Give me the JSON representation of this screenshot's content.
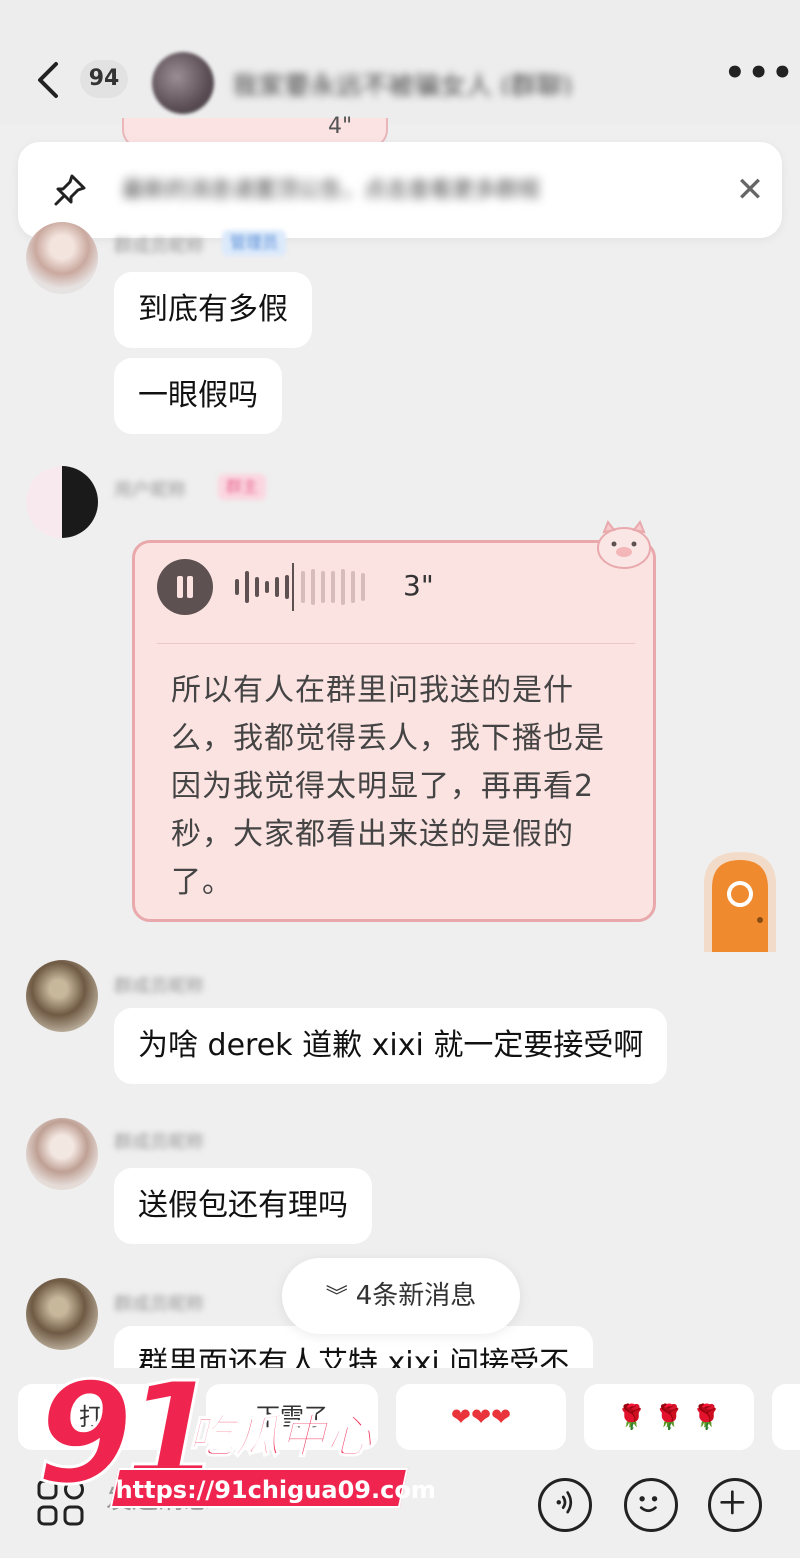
{
  "header": {
    "unread_count": "94",
    "title": "我家要永远不被骗女人 (群聊)"
  },
  "pinned": {
    "text": "最新的消息请置顶公告，点击查看更多群规"
  },
  "messages": [
    {
      "sender": "群成员昵称",
      "role": "管理员",
      "bubbles": [
        "到底有多假",
        "一眼假吗"
      ]
    },
    {
      "sender": "用户昵称",
      "role": "群主",
      "voice": {
        "duration": "3\"",
        "transcript": "所以有人在群里问我送的是什么，我都觉得丢人，我下播也是因为我觉得太明显了，再再看2秒，大家都看出来送的是假的了。"
      }
    },
    {
      "sender": "群成员昵称",
      "bubbles": [
        "为啥 derek 道歉 xixi 就一定要接受啊"
      ]
    },
    {
      "sender": "群成员昵称",
      "bubbles": [
        "送假包还有理吗"
      ]
    },
    {
      "sender": "群成员昵称",
      "bubbles": [
        "群里面还有人艾特 xixi 问接受不"
      ]
    }
  ],
  "peek_voice": {
    "duration": "4\""
  },
  "new_messages": "4条新消息",
  "quick_replies": [
    "打卡",
    "下雪了",
    "❤❤❤",
    "🌹 🌹 🌹"
  ],
  "input": {
    "placeholder": "发送消息"
  },
  "watermark": {
    "number": "91",
    "name": "吃瓜中心",
    "url": "https://91chigua09.com"
  },
  "colors": {
    "accent": "#f0254f",
    "voice_card_bg": "#fbe3e1",
    "voice_card_border": "#e9a9ac"
  }
}
